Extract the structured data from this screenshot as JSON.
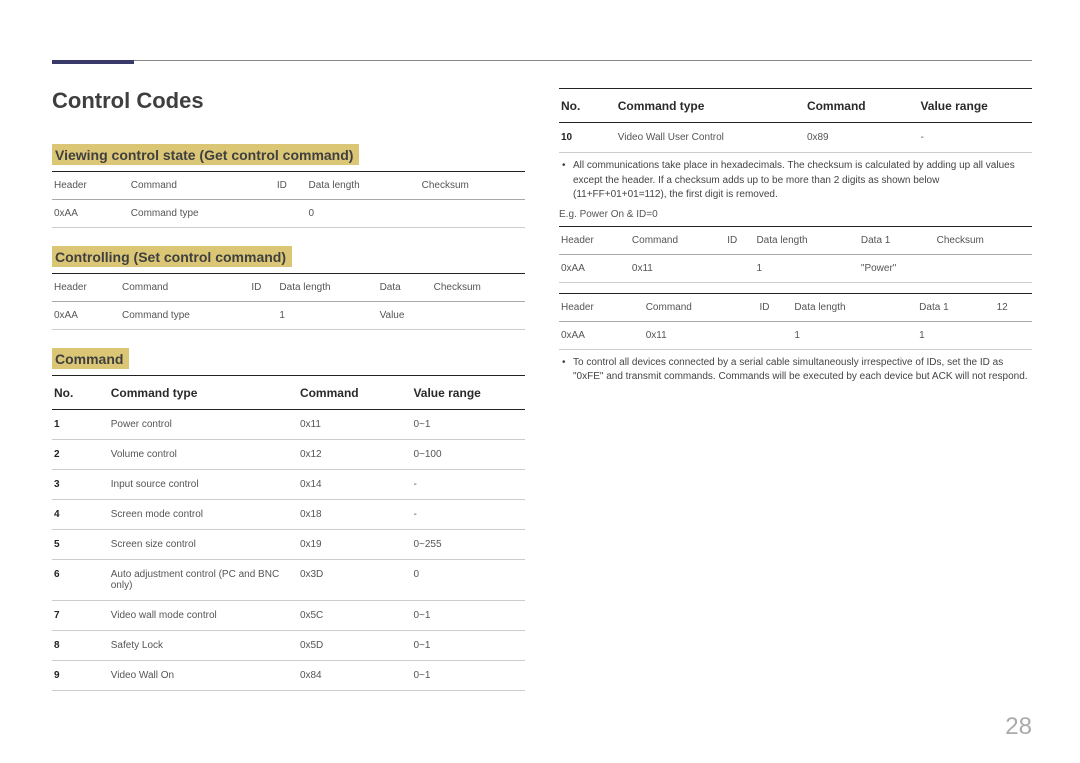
{
  "page_number": "28",
  "title": "Control Codes",
  "left": {
    "s1_title": "Viewing control state (Get control command)",
    "s1_headers": [
      "Header",
      "Command",
      "ID",
      "Data length",
      "Checksum"
    ],
    "s1_row": [
      "0xAA",
      "Command type",
      "",
      "0",
      ""
    ],
    "s2_title": "Controlling (Set control command)",
    "s2_headers": [
      "Header",
      "Command",
      "ID",
      "Data length",
      "Data",
      "Checksum"
    ],
    "s2_row": [
      "0xAA",
      "Command type",
      "",
      "1",
      "Value",
      ""
    ],
    "s3_title": "Command",
    "cmd_headers": [
      "No.",
      "Command type",
      "Command",
      "Value range"
    ],
    "cmd_rows": [
      [
        "1",
        "Power control",
        "0x11",
        "0~1"
      ],
      [
        "2",
        "Volume control",
        "0x12",
        "0~100"
      ],
      [
        "3",
        "Input source control",
        "0x14",
        "-"
      ],
      [
        "4",
        "Screen mode control",
        "0x18",
        "-"
      ],
      [
        "5",
        "Screen size control",
        "0x19",
        "0~255"
      ],
      [
        "6",
        "Auto adjustment control (PC and BNC only)",
        "0x3D",
        "0"
      ],
      [
        "7",
        "Video wall mode control",
        "0x5C",
        "0~1"
      ],
      [
        "8",
        "Safety Lock",
        "0x5D",
        "0~1"
      ],
      [
        "9",
        "Video Wall On",
        "0x84",
        "0~1"
      ]
    ]
  },
  "right": {
    "cmd_headers": [
      "No.",
      "Command type",
      "Command",
      "Value range"
    ],
    "cmd_rows": [
      [
        "10",
        "Video Wall User Control",
        "0x89",
        "-"
      ]
    ],
    "note1": "All communications take place in hexadecimals. The checksum is calculated by adding up all values except the header. If a checksum adds up to be more than 2 digits as shown below (11+FF+01+01=112), the first digit is removed.",
    "eg_label": "E.g. Power On & ID=0",
    "ex_headers": [
      "Header",
      "Command",
      "ID",
      "Data length",
      "Data 1",
      "Checksum"
    ],
    "ex1_row": [
      "0xAA",
      "0x11",
      "",
      "1",
      "\"Power\"",
      ""
    ],
    "ex2_headers": [
      "Header",
      "Command",
      "ID",
      "Data length",
      "Data 1",
      "12"
    ],
    "ex2_row": [
      "0xAA",
      "0x11",
      "",
      "1",
      "1",
      ""
    ],
    "note2": "To control all devices connected by a serial cable simultaneously irrespective of IDs, set the ID as \"0xFE\" and transmit commands. Commands will be executed by each device but ACK will not respond."
  }
}
